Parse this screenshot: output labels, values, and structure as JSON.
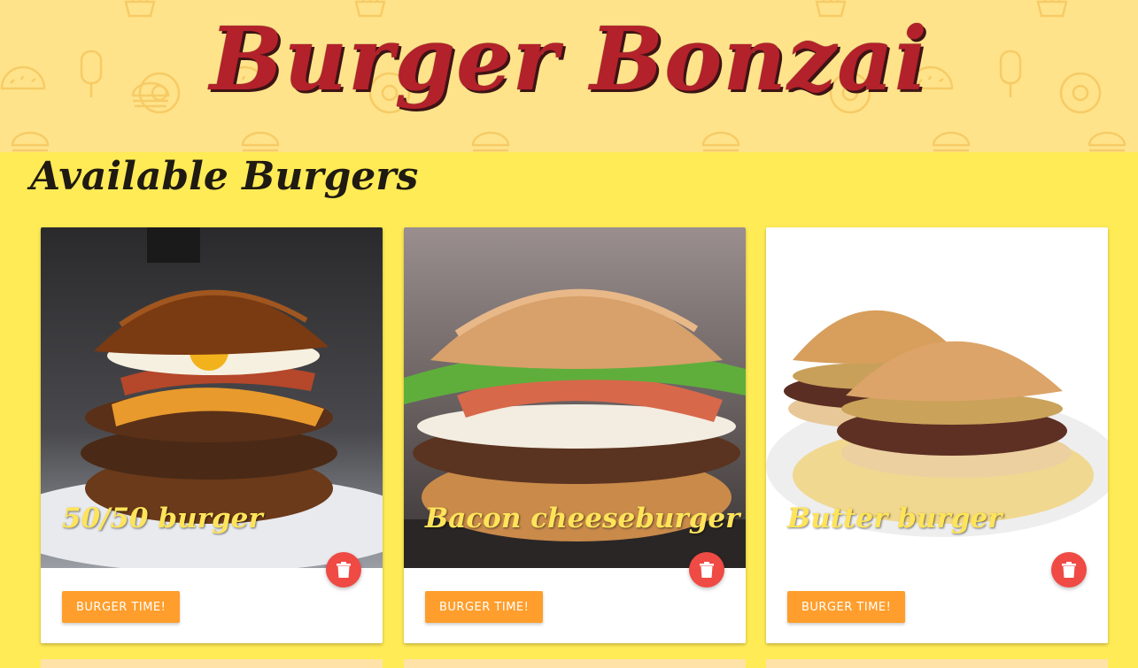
{
  "header": {
    "title": "Burger Bonzai"
  },
  "main": {
    "section_title": "Available Burgers",
    "cards": [
      {
        "title": "50/50 burger",
        "button_label": "Burger time!"
      },
      {
        "title": "Bacon cheeseburger",
        "button_label": "Burger time!"
      },
      {
        "title": "Butter burger",
        "button_label": "Burger time!"
      }
    ]
  },
  "colors": {
    "background": "#ffeb55",
    "header_background": "#ffe38a",
    "title_red": "#b3212a",
    "card_title_yellow": "#ffe45a",
    "button_orange": "#ff9e2c",
    "delete_red": "#ef4a44"
  },
  "icons": {
    "delete": "trash-icon",
    "header_pattern": [
      "burger-icon",
      "taco-icon",
      "donut-icon",
      "popsicle-icon",
      "fries-icon"
    ]
  }
}
